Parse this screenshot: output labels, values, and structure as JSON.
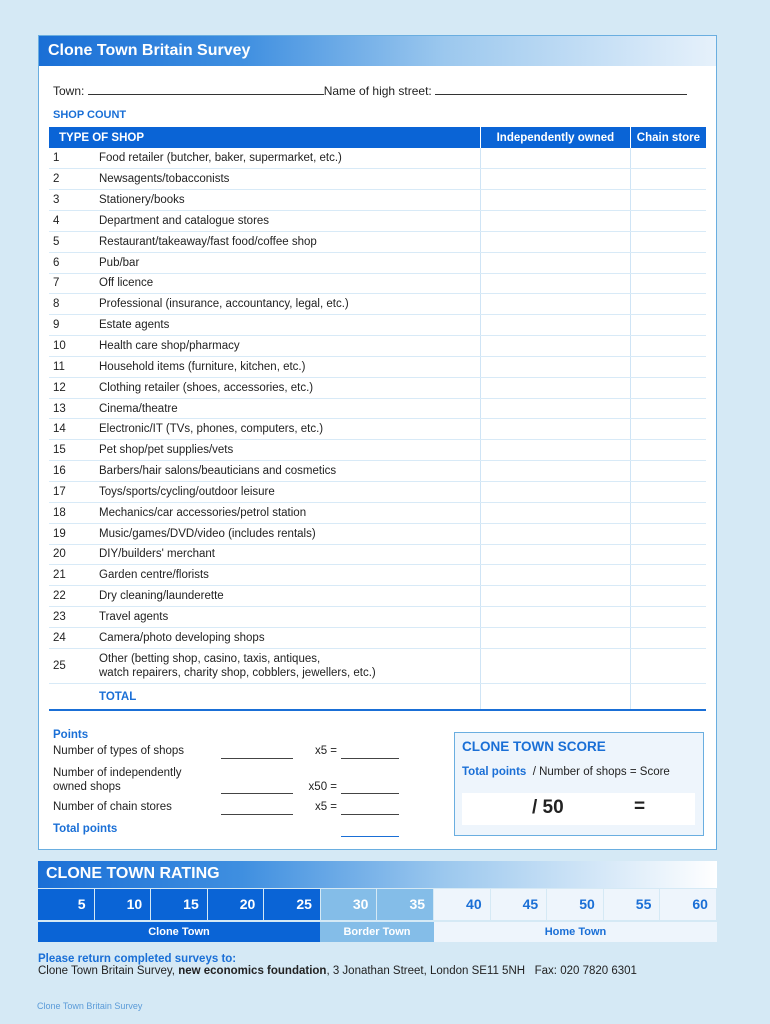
{
  "form": {
    "title": "Clone Town Britain Survey",
    "town_label": "Town:",
    "high_street_label": "Name of high street:",
    "section_label": "SHOP COUNT",
    "columns": {
      "type": "TYPE OF SHOP",
      "independent": "Independently owned",
      "chain": "Chain store"
    },
    "shops": [
      {
        "num": "1",
        "label": "Food retailer (butcher, baker, supermarket, etc.)"
      },
      {
        "num": "2",
        "label": "Newsagents/tobacconists"
      },
      {
        "num": "3",
        "label": "Stationery/books"
      },
      {
        "num": "4",
        "label": "Department and catalogue stores"
      },
      {
        "num": "5",
        "label": "Restaurant/takeaway/fast food/coffee shop"
      },
      {
        "num": "6",
        "label": "Pub/bar"
      },
      {
        "num": "7",
        "label": "Off licence"
      },
      {
        "num": "8",
        "label": "Professional (insurance, accountancy, legal, etc.)"
      },
      {
        "num": "9",
        "label": "Estate agents"
      },
      {
        "num": "10",
        "label": "Health care shop/pharmacy"
      },
      {
        "num": "11",
        "label": "Household items (furniture, kitchen, etc.)"
      },
      {
        "num": "12",
        "label": "Clothing retailer (shoes, accessories, etc.)"
      },
      {
        "num": "13",
        "label": "Cinema/theatre"
      },
      {
        "num": "14",
        "label": "Electronic/IT (TVs, phones, computers, etc.)"
      },
      {
        "num": "15",
        "label": "Pet shop/pet supplies/vets"
      },
      {
        "num": "16",
        "label": "Barbers/hair salons/beauticians and cosmetics"
      },
      {
        "num": "17",
        "label": "Toys/sports/cycling/outdoor leisure"
      },
      {
        "num": "18",
        "label": "Mechanics/car accessories/petrol station"
      },
      {
        "num": "19",
        "label": "Music/games/DVD/video (includes rentals)"
      },
      {
        "num": "20",
        "label": "DIY/builders' merchant"
      },
      {
        "num": "21",
        "label": "Garden centre/florists"
      },
      {
        "num": "22",
        "label": "Dry cleaning/launderette"
      },
      {
        "num": "23",
        "label": "Travel agents"
      },
      {
        "num": "24",
        "label": "Camera/photo developing shops"
      },
      {
        "num": "25",
        "label": "Other (betting shop, casino, taxis, antiques,",
        "label2": "watch repairers, charity shop, cobblers, jewellers, etc.)"
      }
    ],
    "total_label": "TOTAL"
  },
  "points": {
    "title": "Points",
    "rows": [
      {
        "label": "Number of types of shops",
        "mult": "x5 ="
      },
      {
        "label": "Number of independently",
        "label2": "owned shops",
        "mult": "x50 ="
      },
      {
        "label": "Number of chain stores",
        "mult": "x5 ="
      }
    ],
    "total_label": "Total points"
  },
  "score": {
    "title": "CLONE TOWN SCORE",
    "formula_bold": "Total points",
    "formula_rest": "/ Number of shops = Score",
    "divisor": "/ 50",
    "equals": "="
  },
  "rating": {
    "title": "CLONE TOWN RATING",
    "values": [
      "5",
      "10",
      "15",
      "20",
      "25",
      "30",
      "35",
      "40",
      "45",
      "50",
      "55",
      "60"
    ],
    "bands": [
      {
        "label": "Clone Town",
        "color": "#0a64d6"
      },
      {
        "label": "Border Town",
        "color": "#84bde8"
      },
      {
        "label": "Home Town",
        "color": "#eef5fc"
      }
    ]
  },
  "return_info": {
    "title": "Please return completed surveys to:",
    "line_start": "Clone Town Britain Survey, ",
    "org": "new economics foundation",
    "line_end": ", 3 Jonathan Street, London SE11 5NH   Fax: 020 7820 6301"
  },
  "footer": "Clone Town Britain Survey"
}
